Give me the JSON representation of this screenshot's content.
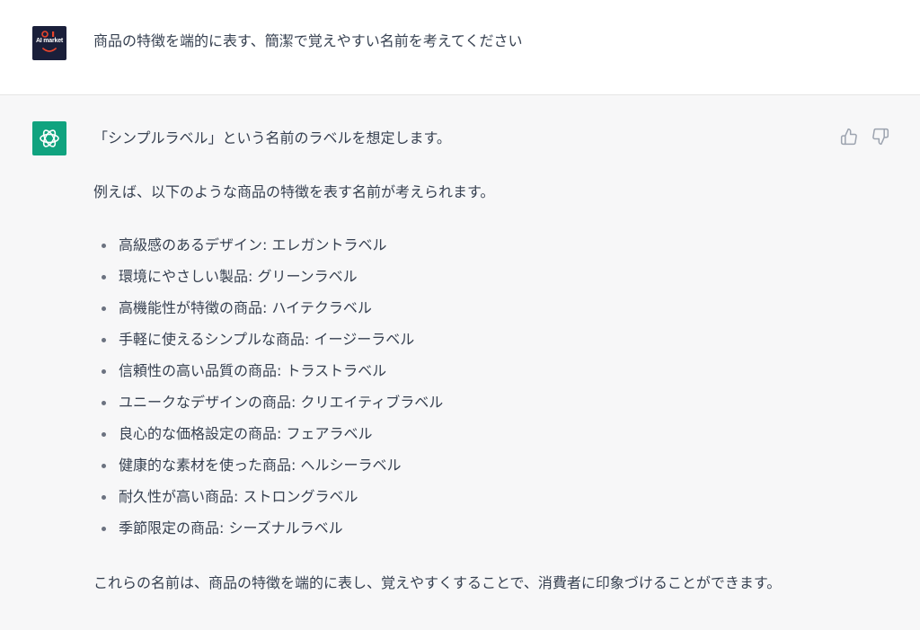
{
  "user_message": {
    "avatar": {
      "icon": "aimarket-logo-icon",
      "logo_text": "AI market",
      "background": "#1a1f3a"
    },
    "text": "商品の特徴を端的に表す、簡潔で覚えやすい名前を考えてください"
  },
  "assistant_message": {
    "avatar": {
      "icon": "openai-logo-icon",
      "background": "#10a37f"
    },
    "intro": "「シンプルラベル」という名前のラベルを想定します。",
    "lead": "例えば、以下のような商品の特徴を表す名前が考えられます。",
    "items": [
      "高級感のあるデザイン: エレガントラベル",
      "環境にやさしい製品: グリーンラベル",
      "高機能性が特徴の商品: ハイテクラベル",
      "手軽に使えるシンプルな商品: イージーラベル",
      "信頼性の高い品質の商品: トラストラベル",
      "ユニークなデザインの商品: クリエイティブラベル",
      "良心的な価格設定の商品: フェアラベル",
      "健康的な素材を使った商品: ヘルシーラベル",
      "耐久性が高い商品: ストロングラベル",
      "季節限定の商品: シーズナルラベル"
    ],
    "closing": "これらの名前は、商品の特徴を端的に表し、覚えやすくすることで、消費者に印象づけることができます。",
    "feedback": {
      "up_icon": "thumbs-up-icon",
      "down_icon": "thumbs-down-icon"
    }
  },
  "colors": {
    "user_row_bg": "#ffffff",
    "assistant_row_bg": "#f7f7f8",
    "text": "#374151",
    "accent": "#10a37f"
  }
}
